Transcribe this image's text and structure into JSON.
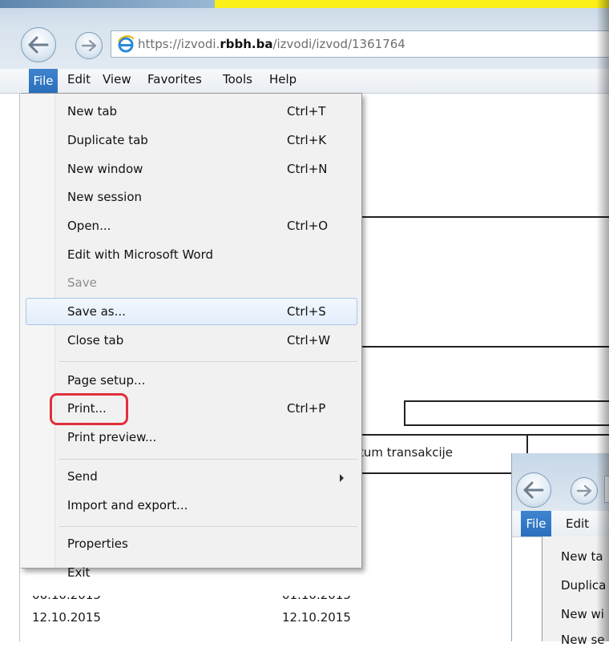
{
  "browser": {
    "url_scheme": "https://",
    "url_host_prefix": "izvodi.",
    "url_host_domain": "rbbh.ba",
    "url_path": "/izvodi/izvod/1361764"
  },
  "menubar": {
    "items": [
      "File",
      "Edit",
      "View",
      "Favorites",
      "Tools",
      "Help"
    ]
  },
  "file_menu": {
    "items": [
      {
        "label": "New tab",
        "shortcut": "Ctrl+T"
      },
      {
        "label": "Duplicate tab",
        "shortcut": "Ctrl+K"
      },
      {
        "label": "New window",
        "shortcut": "Ctrl+N"
      },
      {
        "label": "New session",
        "shortcut": ""
      },
      {
        "label": "Open...",
        "shortcut": "Ctrl+O"
      },
      {
        "label": "Edit with Microsoft Word",
        "shortcut": ""
      },
      {
        "label": "Save",
        "shortcut": ""
      },
      {
        "label": "Save as...",
        "shortcut": "Ctrl+S"
      },
      {
        "label": "Close tab",
        "shortcut": "Ctrl+W"
      },
      {
        "label": "Page setup...",
        "shortcut": ""
      },
      {
        "label": "Print...",
        "shortcut": "Ctrl+P"
      },
      {
        "label": "Print preview...",
        "shortcut": ""
      },
      {
        "label": "Send",
        "shortcut": ""
      },
      {
        "label": "Import and export...",
        "shortcut": ""
      },
      {
        "label": "Properties",
        "shortcut": ""
      },
      {
        "label": "Exit",
        "shortcut": ""
      }
    ]
  },
  "page": {
    "column_header_fragment": "tum transakcije",
    "rows": [
      {
        "date1": "06.10.2015",
        "date2": "01.10.2015"
      },
      {
        "date1": "12.10.2015",
        "date2": "12.10.2015"
      }
    ]
  },
  "overlay_window": {
    "menubar": [
      "File",
      "Edit"
    ],
    "items": [
      "New ta",
      "Duplica",
      "New wi",
      "New se"
    ]
  },
  "colors": {
    "highlight_ring": "#e0303a",
    "menu_hover": "#e3eefb",
    "file_menu_active": "#2a6fbc",
    "top_banner": "#fbf018"
  }
}
